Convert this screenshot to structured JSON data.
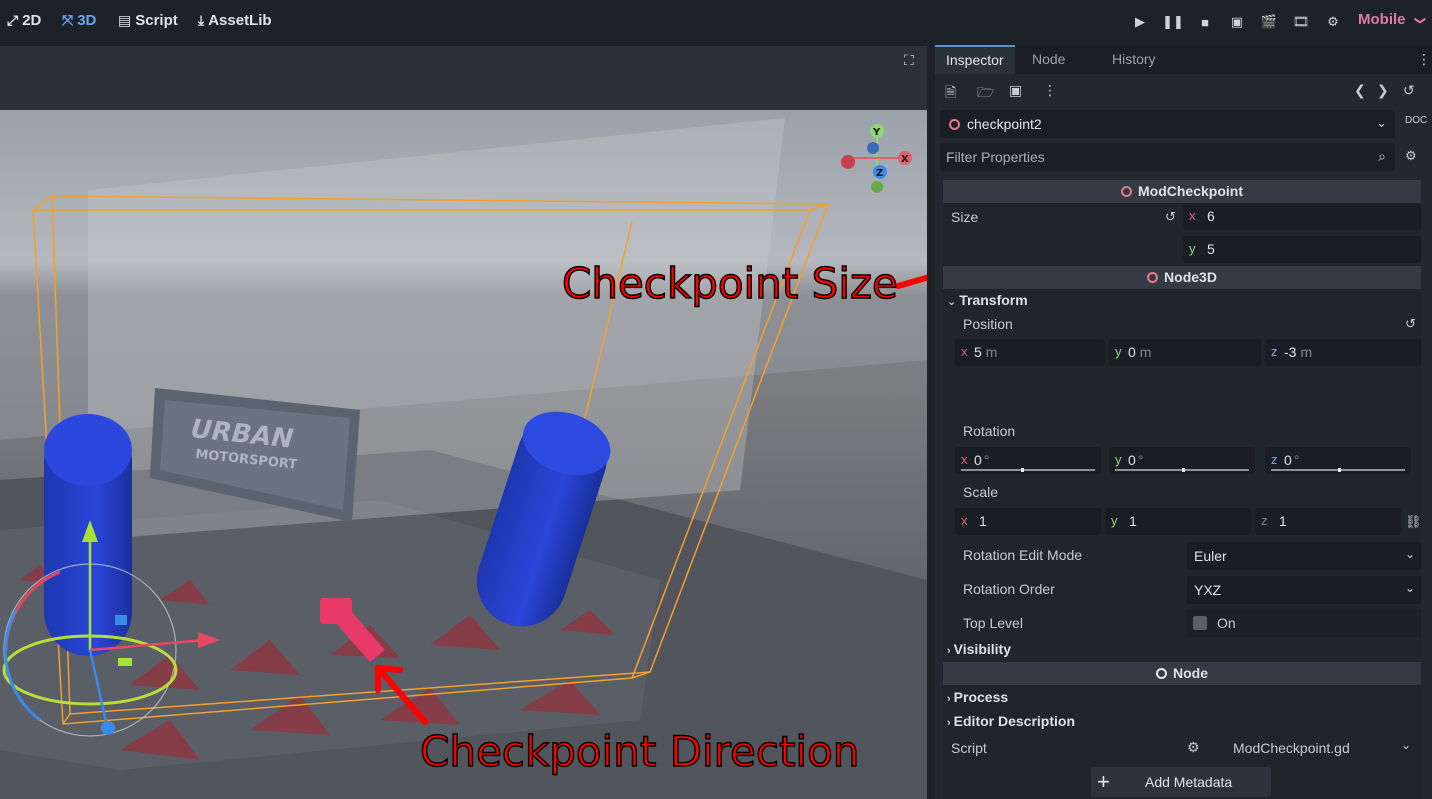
{
  "topbar": {
    "modes": [
      {
        "label": "2D",
        "icon": "2d-icon",
        "active": false
      },
      {
        "label": "3D",
        "icon": "3d-icon",
        "active": true
      },
      {
        "label": "Script",
        "icon": "script-icon",
        "active": false
      },
      {
        "label": "AssetLib",
        "icon": "assetlib-icon",
        "active": false
      }
    ],
    "renderer": "Mobile",
    "renderer_chevron": "❯"
  },
  "viewport": {
    "annotations": {
      "size_label": "Checkpoint Size",
      "direction_label": "Checkpoint Direction"
    },
    "sign_text": {
      "line1": "URBAN",
      "line2": "MOTORSPORT"
    },
    "gizmo_axes": {
      "x": "X",
      "y": "Y",
      "z": "Z"
    }
  },
  "dock": {
    "tabs": [
      "Inspector",
      "Node",
      "History"
    ],
    "object_name": "checkpoint2",
    "filter_placeholder": "Filter Properties",
    "sections": {
      "mod_checkpoint": "ModCheckpoint",
      "node3d": "Node3D",
      "node": "Node"
    },
    "size": {
      "label": "Size",
      "x": "6",
      "y": "5"
    },
    "transform": {
      "group_label": "Transform",
      "position": {
        "label": "Position",
        "x": "5",
        "y": "0",
        "z": "-3",
        "unit": "m"
      },
      "rotation": {
        "label": "Rotation",
        "x": "0",
        "y": "0",
        "z": "0",
        "unit": "°"
      },
      "scale": {
        "label": "Scale",
        "x": "1",
        "y": "1",
        "z": "1"
      },
      "rotation_edit_mode": {
        "label": "Rotation Edit Mode",
        "value": "Euler"
      },
      "rotation_order": {
        "label": "Rotation Order",
        "value": "YXZ"
      },
      "top_level": {
        "label": "Top Level",
        "value": "On"
      }
    },
    "groups": {
      "visibility": "Visibility",
      "process": "Process",
      "editor_description": "Editor Description"
    },
    "script": {
      "label": "Script",
      "value": "ModCheckpoint.gd"
    },
    "add_metadata": "Add Metadata",
    "axis_letters": {
      "x": "x",
      "y": "y",
      "z": "z"
    }
  }
}
